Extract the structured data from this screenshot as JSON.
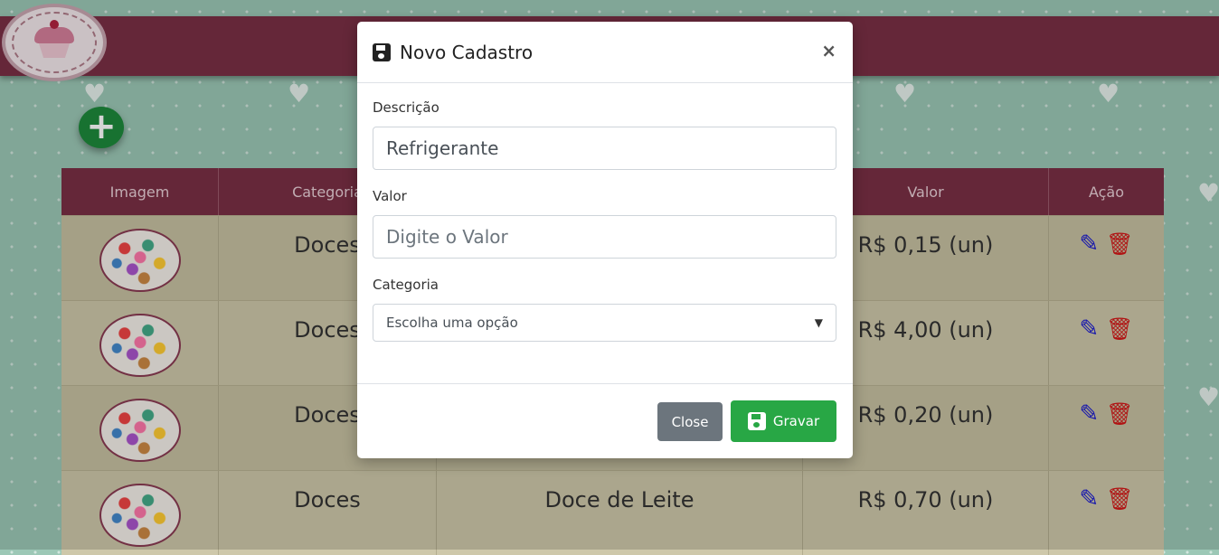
{
  "header": {
    "logo_icon": "cupcake-logo-icon"
  },
  "toolbar": {
    "add_icon": "plus-icon"
  },
  "table": {
    "columns": [
      "Imagem",
      "Categoria",
      "",
      "Valor",
      "Ação"
    ],
    "rows": [
      {
        "categoria": "Doces",
        "descricao": "",
        "valor": "R$ 0,15 (un)"
      },
      {
        "categoria": "Doces",
        "descricao": "",
        "valor": "R$ 4,00 (un)"
      },
      {
        "categoria": "Doces",
        "descricao": "",
        "valor": "R$ 0,20 (un)"
      },
      {
        "categoria": "Doces",
        "descricao": "Doce de Leite",
        "valor": "R$ 0,70 (un)"
      }
    ]
  },
  "modal": {
    "title": "Novo Cadastro",
    "close_symbol": "×",
    "descricao_label": "Descrição",
    "descricao_value": "Refrigerante",
    "valor_label": "Valor",
    "valor_placeholder": "Digite o Valor",
    "categoria_label": "Categoria",
    "categoria_selected": "Escolha uma opção",
    "close_button": "Close",
    "save_button": "Gravar"
  },
  "colors": {
    "header": "#7a2f45",
    "save": "#28a745",
    "close": "#6c757d",
    "edit": "#1a1ad0",
    "delete": "#d41818"
  }
}
